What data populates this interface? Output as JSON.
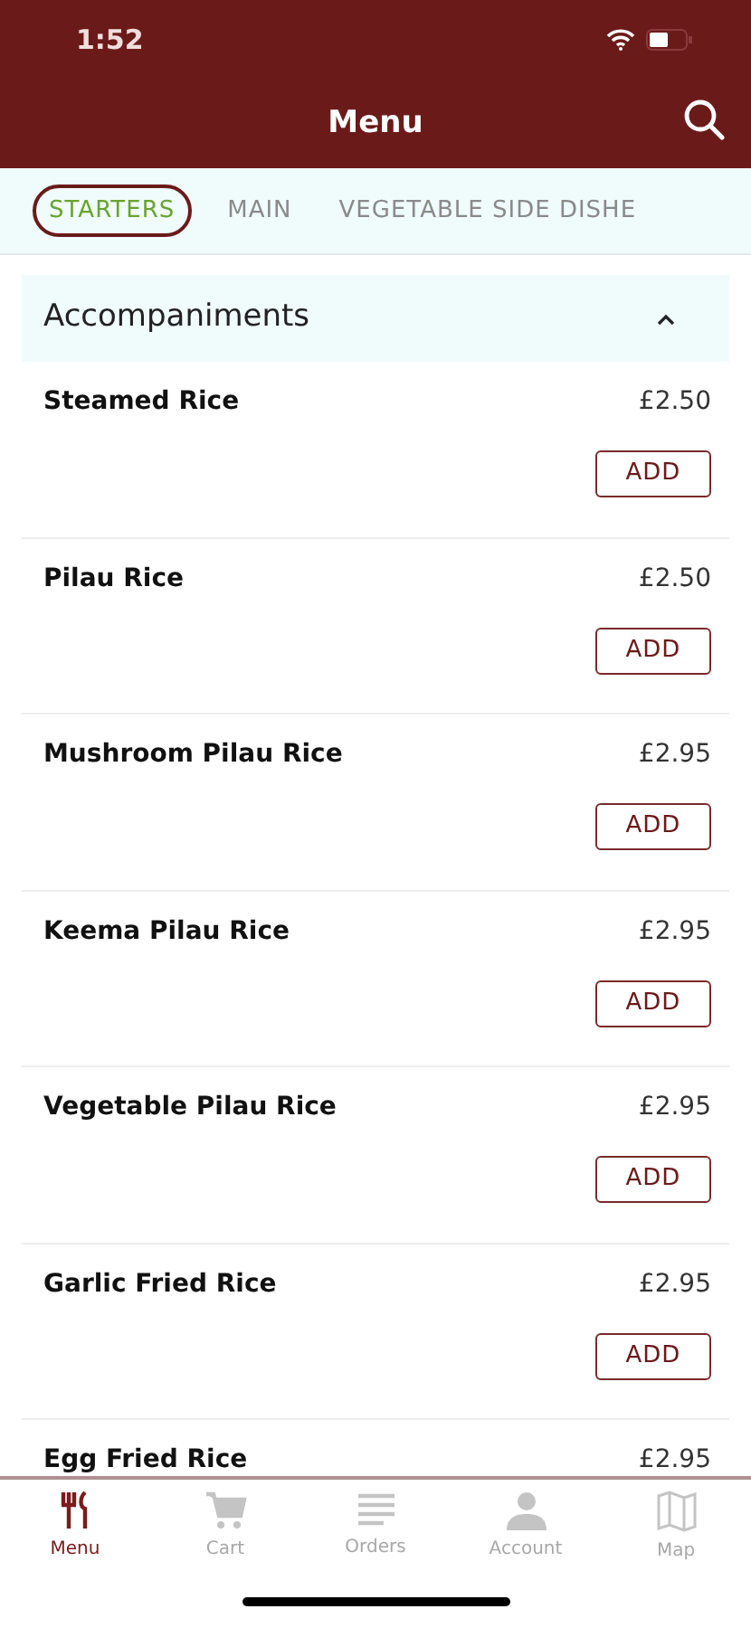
{
  "status_bar": {
    "time": "1:52"
  },
  "header": {
    "title": "Menu"
  },
  "tabs": [
    {
      "label": "STARTERS",
      "selected": true
    },
    {
      "label": "MAIN",
      "selected": false
    },
    {
      "label": "VEGETABLE SIDE DISHE",
      "selected": false
    }
  ],
  "section": {
    "title": "Accompaniments",
    "expanded": true
  },
  "items": [
    {
      "name": "Steamed Rice",
      "price": "£2.50",
      "button": "ADD"
    },
    {
      "name": "Pilau Rice",
      "price": "£2.50",
      "button": "ADD"
    },
    {
      "name": "Mushroom Pilau Rice",
      "price": "£2.95",
      "button": "ADD"
    },
    {
      "name": "Keema Pilau Rice",
      "price": "£2.95",
      "button": "ADD"
    },
    {
      "name": "Vegetable Pilau Rice",
      "price": "£2.95",
      "button": "ADD"
    },
    {
      "name": "Garlic Fried Rice",
      "price": "£2.95",
      "button": "ADD"
    },
    {
      "name": "Egg Fried Rice",
      "price": "£2.95"
    }
  ],
  "bottom_nav": [
    {
      "kind": "menu",
      "label": "Menu",
      "selected": true
    },
    {
      "kind": "cart",
      "label": "Cart",
      "selected": false
    },
    {
      "kind": "orders",
      "label": "Orders",
      "selected": false
    },
    {
      "kind": "account",
      "label": "Account",
      "selected": false
    },
    {
      "kind": "map",
      "label": "Map",
      "selected": false
    }
  ]
}
